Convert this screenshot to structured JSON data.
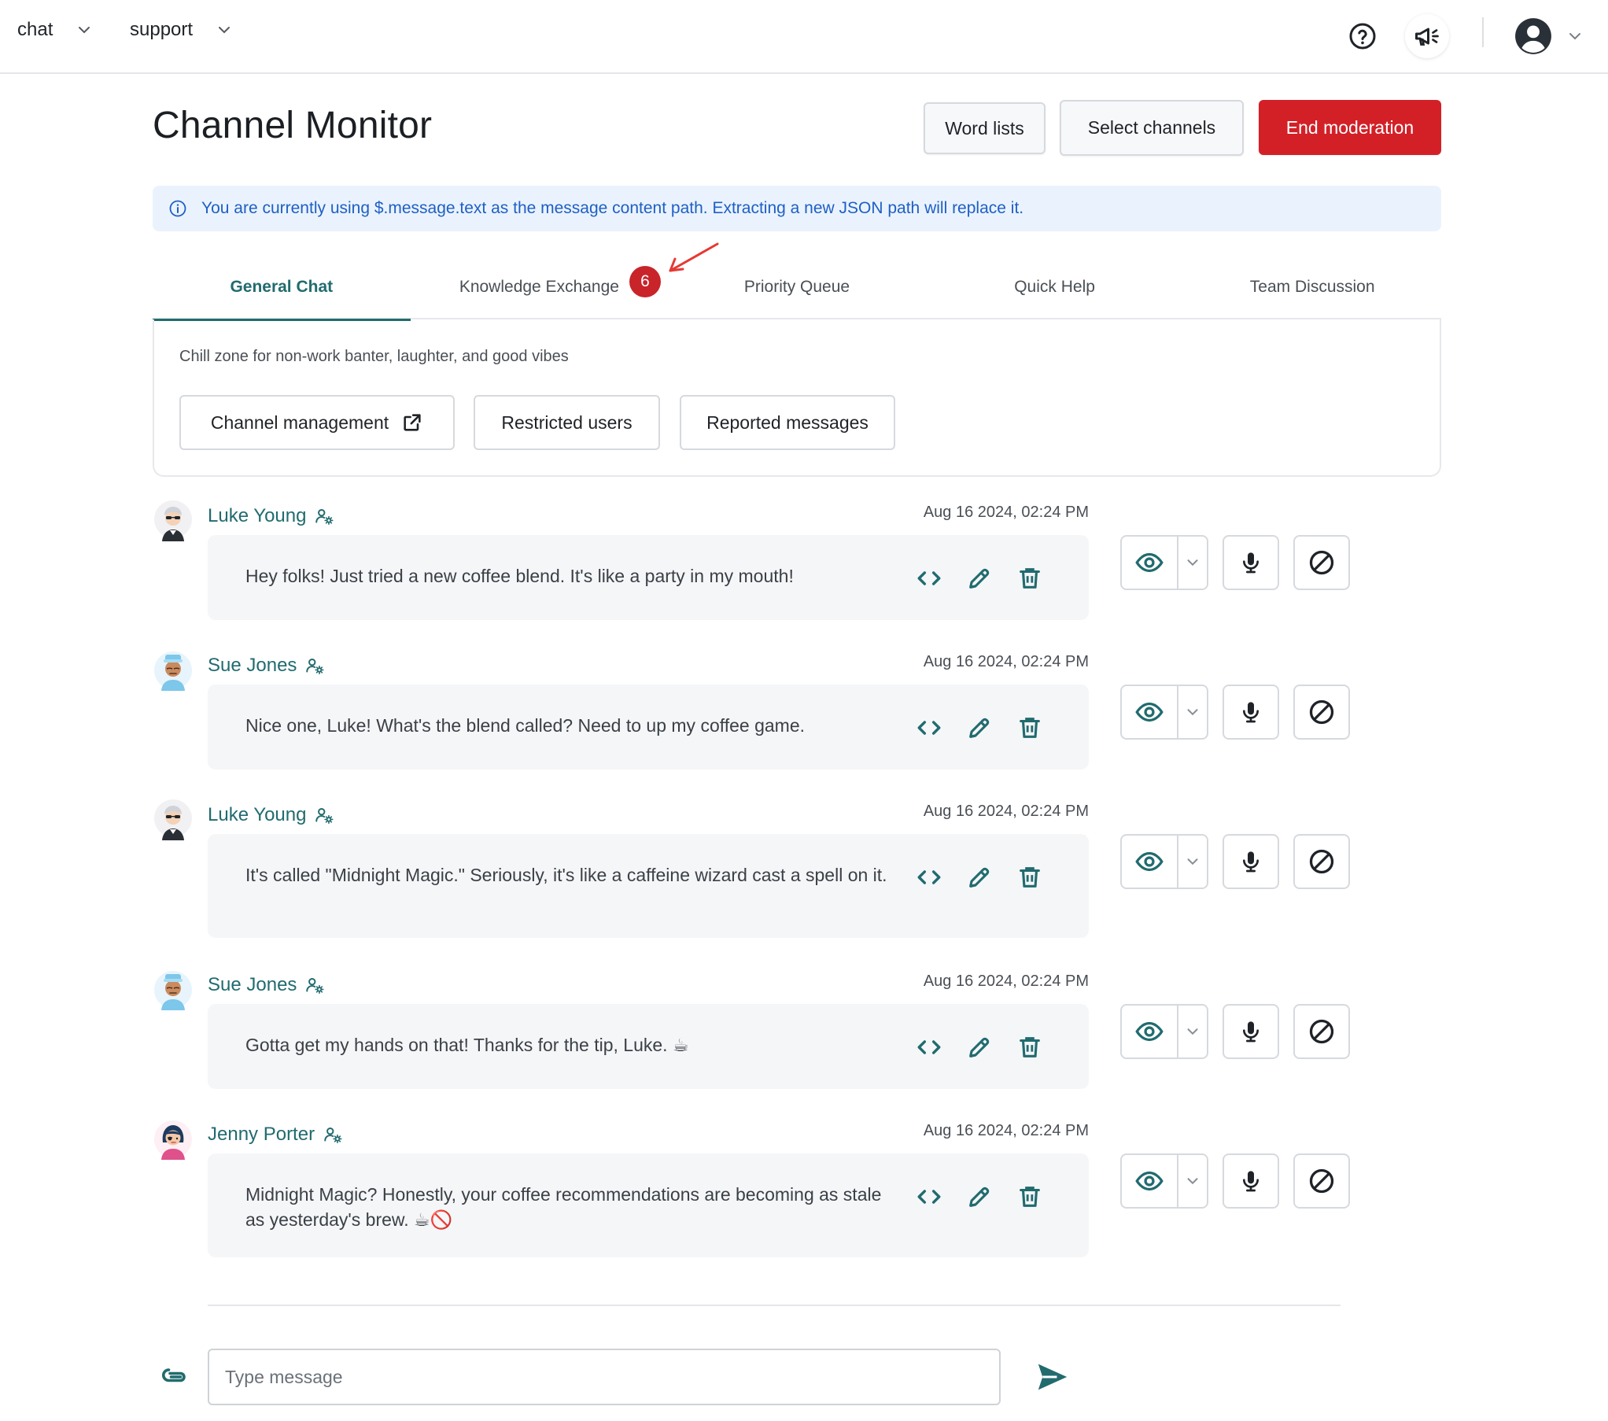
{
  "topbar": {
    "nav": [
      {
        "label": "chat"
      },
      {
        "label": "support"
      }
    ]
  },
  "header": {
    "title": "Channel Monitor",
    "buttons": {
      "word_lists": "Word lists",
      "select_channels": "Select channels",
      "end_moderation": "End moderation"
    }
  },
  "info_banner": {
    "text": "You are currently using $.message.text as the message content path. Extracting a new JSON path will replace it."
  },
  "tabs": [
    {
      "label": "General Chat",
      "active": true
    },
    {
      "label": "Knowledge Exchange",
      "badge": "6"
    },
    {
      "label": "Priority Queue"
    },
    {
      "label": "Quick Help"
    },
    {
      "label": "Team Discussion"
    }
  ],
  "channel": {
    "description": "Chill zone for non-work banter, laughter, and good vibes",
    "buttons": {
      "management": "Channel management",
      "restricted": "Restricted users",
      "reported": "Reported messages"
    }
  },
  "messages": [
    {
      "author": "Luke Young",
      "avatar": "luke",
      "time": "Aug 16 2024, 02:24 PM",
      "text": "Hey folks! Just tried a new coffee blend. It's like a party in my mouth!"
    },
    {
      "author": "Sue Jones",
      "avatar": "sue",
      "time": "Aug 16 2024, 02:24 PM",
      "text": "Nice one, Luke! What's the blend called? Need to up my coffee game."
    },
    {
      "author": "Luke Young",
      "avatar": "luke",
      "time": "Aug 16 2024, 02:24 PM",
      "text": "It's called \"Midnight Magic.\" Seriously, it's like a caffeine wizard cast a spell on it."
    },
    {
      "author": "Sue Jones",
      "avatar": "sue",
      "time": "Aug 16 2024, 02:24 PM",
      "text": "Gotta get my hands on that! Thanks for the tip, Luke. ☕"
    },
    {
      "author": "Jenny Porter",
      "avatar": "jenny",
      "time": "Aug 16 2024, 02:24 PM",
      "text": "Midnight Magic? Honestly, your coffee recommendations are becoming as stale as yesterday's brew. ☕🚫"
    }
  ],
  "composer": {
    "placeholder": "Type message",
    "value": ""
  },
  "colors": {
    "accent": "#216b6f",
    "danger": "#d32027",
    "info_bg": "#eaf3fd",
    "info_text": "#1f5fc4",
    "badge": "#c8242a"
  },
  "icons": {
    "help": "help-circle-icon",
    "announce": "megaphone-icon",
    "user": "user-avatar-icon",
    "external": "external-link-icon",
    "code": "code-icon",
    "edit": "pencil-icon",
    "delete": "trash-icon",
    "view": "eye-icon",
    "mic": "microphone-icon",
    "ban": "ban-icon",
    "attach": "paperclip-icon",
    "send": "send-icon"
  }
}
